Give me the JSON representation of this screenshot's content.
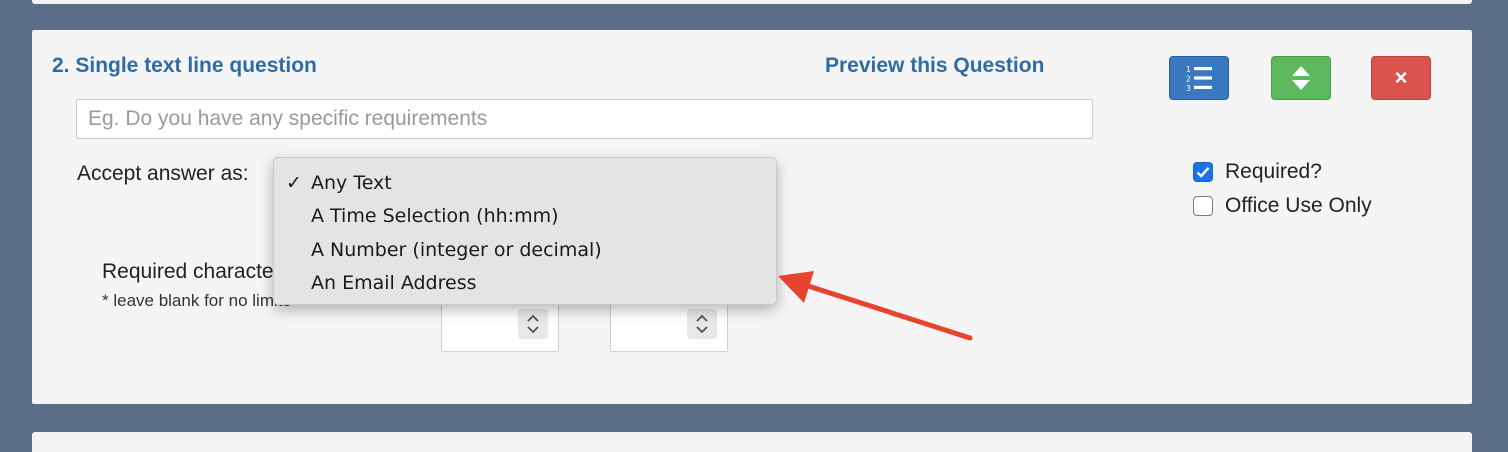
{
  "question": {
    "title": "2. Single text line question",
    "preview_label": "Preview this Question",
    "input_placeholder": "Eg. Do you have any specific requirements",
    "input_value": ""
  },
  "toolbar": {
    "list_button_icon": "ordered-list-icon",
    "reorder_button_icon": "sort-arrows-icon",
    "delete_button_label": "×"
  },
  "accept_answer": {
    "label": "Accept answer as:",
    "selected": "Any Text",
    "options": [
      {
        "label": "Any Text",
        "checked": true
      },
      {
        "label": "A Time Selection (hh:mm)",
        "checked": false
      },
      {
        "label": "A Number (integer or decimal)",
        "checked": false
      },
      {
        "label": "An Email Address",
        "checked": false
      }
    ],
    "check_mark": "✓"
  },
  "required_characters": {
    "label": "Required characters",
    "note": "* leave blank for no limits",
    "min_value": "",
    "max_value": ""
  },
  "options": {
    "required_label": "Required?",
    "required_checked": true,
    "office_use_label": "Office Use Only",
    "office_use_checked": false
  },
  "colors": {
    "page_background": "#5a6e88",
    "panel_background": "#f5f5f5",
    "link_blue": "#2e6da4",
    "button_blue": "#3a78c0",
    "button_green": "#5cb85c",
    "button_red": "#d9534f",
    "annotation_arrow": "#e8432e"
  }
}
